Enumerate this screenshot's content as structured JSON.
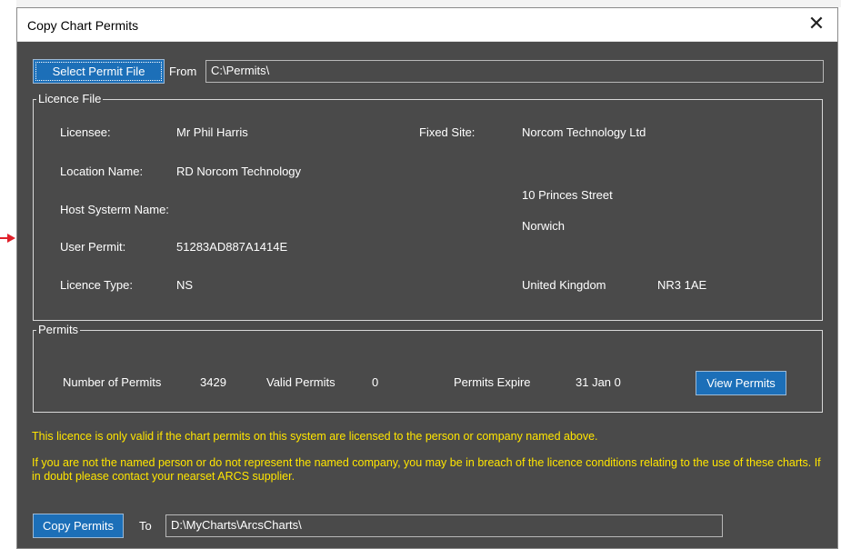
{
  "window": {
    "title": "Copy Chart Permits",
    "close_glyph": "✕"
  },
  "source": {
    "select_button_label": "Select Permit File",
    "from_label": "From",
    "from_path": "C:\\Permits\\"
  },
  "licence_file": {
    "group_title": "Licence File",
    "licensee_label": "Licensee:",
    "licensee_value": "Mr Phil Harris",
    "location_label": "Location Name:",
    "location_value": "RD Norcom Technology",
    "host_label": "Host Systerm Name:",
    "host_value": "",
    "user_permit_label": "User Permit:",
    "user_permit_value": "51283AD887A1414E",
    "licence_type_label": "Licence Type:",
    "licence_type_value": "NS",
    "fixed_site_label": "Fixed Site:",
    "fixed_site_value": "Norcom Technology Ltd",
    "address_line1": "10 Princes Street",
    "address_line2": "Norwich",
    "country": "United Kingdom",
    "postcode": "NR3 1AE"
  },
  "permits": {
    "group_title": "Permits",
    "number_label": "Number of Permits",
    "number_value": "3429",
    "valid_label": "Valid Permits",
    "valid_value": "0",
    "expire_label": "Permits Expire",
    "expire_value": "31 Jan  0",
    "view_button_label": "View Permits"
  },
  "notices": {
    "line1": "This licence is only valid if the chart permits on this system are licensed to the person or company named above.",
    "line2": "If you are not the named person or do not represent the named company, you may be in breach of the licence conditions relating to the use of these charts. If in doubt please contact your nearset ARCS supplier."
  },
  "destination": {
    "copy_button_label": "Copy Permits",
    "to_label": "To",
    "to_path": "D:\\MyCharts\\ArcsCharts\\"
  },
  "colors": {
    "dialog_bg": "#4a4a4a",
    "button_blue": "#1c6fb8",
    "notice_yellow": "#ffe500",
    "arrow_red": "#e0202a"
  }
}
